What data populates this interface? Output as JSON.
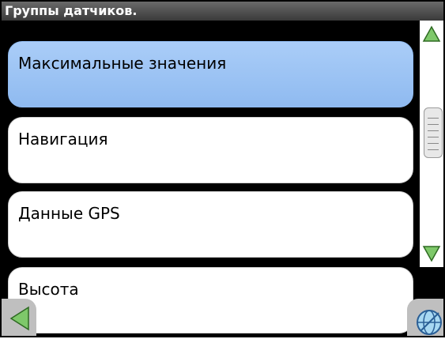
{
  "window": {
    "title": "Группы датчиков."
  },
  "list": {
    "items": [
      {
        "label": "Максимальные значения",
        "selected": true
      },
      {
        "label": "Навигация",
        "selected": false
      },
      {
        "label": "Данные GPS",
        "selected": false
      },
      {
        "label": "Высота",
        "selected": false
      }
    ]
  },
  "scrollbar": {
    "up_icon": "triangle-up-icon",
    "down_icon": "triangle-down-icon"
  },
  "footer": {
    "back_icon": "triangle-left-icon",
    "map_icon": "globe-icon"
  },
  "colors": {
    "accent": "#9cc2f4",
    "arrow_green": "#7ec86a"
  }
}
